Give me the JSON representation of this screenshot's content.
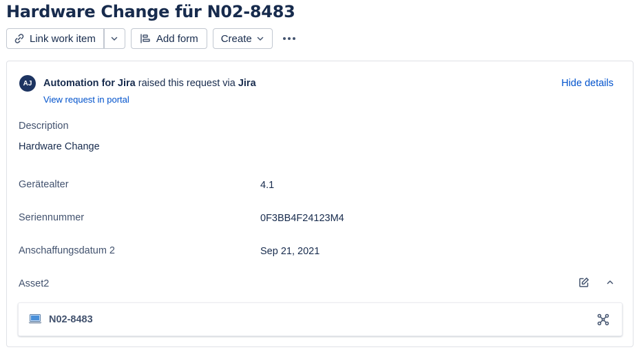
{
  "issue": {
    "title": "Hardware Change für N02-8483"
  },
  "toolbar": {
    "link_label": "Link work item",
    "add_form_label": "Add form",
    "create_label": "Create"
  },
  "request": {
    "avatar_initials": "AJ",
    "reporter": "Automation for Jira",
    "raised_text": " raised this request via ",
    "channel": "Jira",
    "portal_link": "View request in portal",
    "hide_details": "Hide details"
  },
  "description": {
    "label": "Description",
    "value": "Hardware Change"
  },
  "fields": [
    {
      "label": "Gerätealter",
      "value": "4.1"
    },
    {
      "label": "Seriennummer",
      "value": "0F3BB4F24123M4"
    },
    {
      "label": "Anschaffungsdatum 2",
      "value": "Sep 21, 2021"
    }
  ],
  "asset": {
    "label": "Asset2",
    "item_name": "N02-8483",
    "item_icon": "laptop-icon"
  },
  "colors": {
    "link": "#0052cc",
    "avatar_bg": "#1d3461",
    "text": "#172b4d",
    "muted": "#42526e"
  }
}
